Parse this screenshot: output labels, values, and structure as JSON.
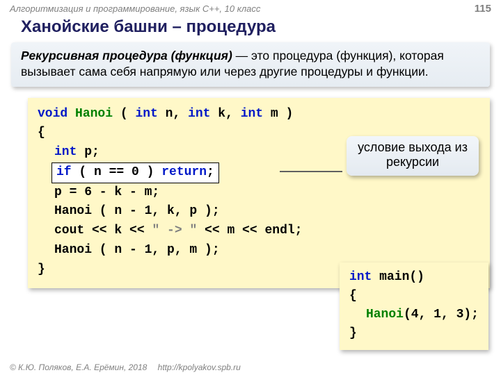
{
  "header": {
    "course": "Алгоритмизация и программирование, язык  C++, 10 класс",
    "page": "115"
  },
  "title": "Ханойские башни – процедура",
  "definition": {
    "strong": "Рекурсивная процедура (функция)",
    "rest": " — это процедура (функция), которая вызывает сама себя напрямую или через другие процедуры и функции."
  },
  "code": {
    "sig_void": "void",
    "sig_name": " Hanoi ",
    "sig_open": "( ",
    "sig_int1": "int",
    "sig_n": " n, ",
    "sig_int2": "int",
    "sig_k": " k, ",
    "sig_int3": "int",
    "sig_m": " m )",
    "brace_open": "{",
    "decl_int": "int",
    "decl_p": " p;",
    "if_kw": "if",
    "if_cond": " ( n == 0 ) ",
    "return_kw": "return",
    "semicolon": ";",
    "assign": "p = 6 - k - m;",
    "call1": "Hanoi ( n - 1, k, p );",
    "cout_a": "cout << k << ",
    "cout_str": "\" -> \"",
    "cout_b": " << m << endl;",
    "call2": "Hanoi ( n - 1, p, m );",
    "brace_close": "}"
  },
  "callout": {
    "line1": "условие выхода из",
    "line2": "рекурсии"
  },
  "main": {
    "sig_int": "int",
    "sig_rest": " main()",
    "brace_open": "{",
    "call_name": "Hanoi",
    "call_args": "(4, 1, 3);",
    "brace_close": "}"
  },
  "footer": {
    "copyright": "© К.Ю. Поляков, Е.А. Ерёмин, 2018",
    "url": "http://kpolyakov.spb.ru"
  }
}
